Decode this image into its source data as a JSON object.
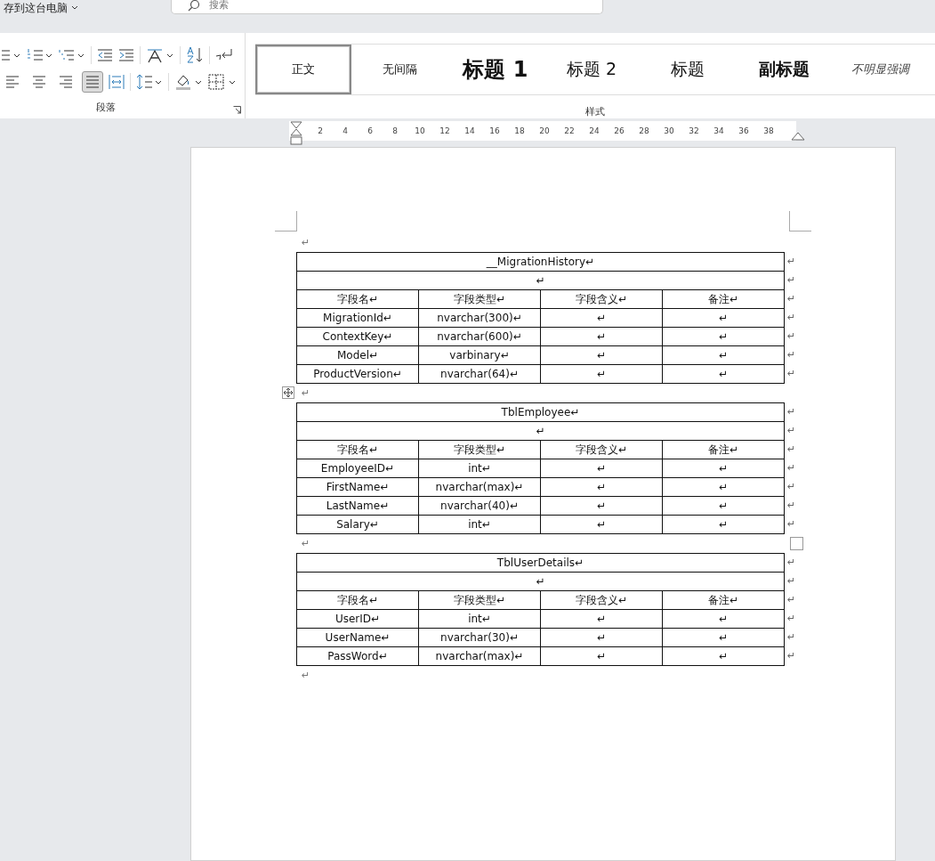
{
  "top_bar": {
    "save_location": "存到这台电脑",
    "search": {
      "placeholder": "搜索"
    }
  },
  "ribbon": {
    "paragraph": {
      "label": "段落",
      "align_buttons": [
        {
          "selected": false
        },
        {
          "selected": false
        },
        {
          "selected": false
        },
        {
          "selected": true
        }
      ]
    },
    "styles": {
      "label": "样式",
      "items": [
        {
          "label": "正文",
          "kind": "normal",
          "selected": true
        },
        {
          "label": "无间隔",
          "kind": "normal",
          "selected": false
        },
        {
          "label": "标题 1",
          "kind": "heading1",
          "selected": false
        },
        {
          "label": "标题 2",
          "kind": "heading2",
          "selected": false
        },
        {
          "label": "标题",
          "kind": "title",
          "selected": false
        },
        {
          "label": "副标题",
          "kind": "subtitle",
          "selected": false
        },
        {
          "label": "不明显强调",
          "kind": "emphasis",
          "selected": false
        }
      ]
    }
  },
  "ruler": [
    "2",
    "4",
    "6",
    "8",
    "10",
    "12",
    "14",
    "16",
    "18",
    "20",
    "22",
    "24",
    "26",
    "28",
    "30",
    "32",
    "34",
    "36",
    "38"
  ],
  "document": [
    {
      "kind": "paragraph",
      "text": "↵"
    },
    {
      "kind": "table",
      "rows": [
        {
          "cells": [
            {
              "text": "__MigrationHistory↵",
              "colspan": 4
            }
          ],
          "end": "↵"
        },
        {
          "cells": [
            {
              "text": "↵",
              "colspan": 4
            }
          ],
          "end": "↵"
        },
        {
          "cells": [
            "字段名↵",
            "字段类型↵",
            "字段含义↵",
            "备注↵"
          ],
          "end": "↵"
        },
        {
          "cells": [
            "MigrationId↵",
            "nvarchar(300)↵",
            "↵",
            "↵"
          ],
          "end": "↵"
        },
        {
          "cells": [
            "ContextKey↵",
            "nvarchar(600)↵",
            "↵",
            "↵"
          ],
          "end": "↵"
        },
        {
          "cells": [
            "Model↵",
            "varbinary↵",
            "↵",
            "↵"
          ],
          "end": "↵"
        },
        {
          "cells": [
            "ProductVersion↵",
            "nvarchar(64)↵",
            "↵",
            "↵"
          ],
          "end": "↵"
        }
      ]
    },
    {
      "kind": "paragraph",
      "text": "↵"
    },
    {
      "kind": "table",
      "rows": [
        {
          "cells": [
            {
              "text": "TblEmployee↵",
              "colspan": 4
            }
          ],
          "end": "↵"
        },
        {
          "cells": [
            {
              "text": "↵",
              "colspan": 4
            }
          ],
          "end": "↵"
        },
        {
          "cells": [
            "字段名↵",
            "字段类型↵",
            "字段含义↵",
            "备注↵"
          ],
          "end": "↵"
        },
        {
          "cells": [
            "EmployeeID↵",
            "int↵",
            "↵",
            "↵"
          ],
          "end": "↵"
        },
        {
          "cells": [
            "FirstName↵",
            "nvarchar(max)↵",
            "↵",
            "↵"
          ],
          "end": "↵"
        },
        {
          "cells": [
            "LastName↵",
            "nvarchar(40)↵",
            "↵",
            "↵"
          ],
          "end": "↵"
        },
        {
          "cells": [
            "Salary↵",
            "int↵",
            "↵",
            "↵"
          ],
          "end": "↵"
        }
      ]
    },
    {
      "kind": "paragraph",
      "text": "↵"
    },
    {
      "kind": "table",
      "rows": [
        {
          "cells": [
            {
              "text": "TblUserDetails↵",
              "colspan": 4
            }
          ],
          "end": "↵"
        },
        {
          "cells": [
            {
              "text": "↵",
              "colspan": 4
            }
          ],
          "end": "↵"
        },
        {
          "cells": [
            "字段名↵",
            "字段类型↵",
            "字段含义↵",
            "备注↵"
          ],
          "end": "↵"
        },
        {
          "cells": [
            "UserID↵",
            "int↵",
            "↵",
            "↵"
          ],
          "end": "↵"
        },
        {
          "cells": [
            "UserName↵",
            "nvarchar(30)↵",
            "↵",
            "↵"
          ],
          "end": "↵"
        },
        {
          "cells": [
            "PassWord↵",
            "nvarchar(max)↵",
            "↵",
            "↵"
          ],
          "end": "↵"
        }
      ]
    },
    {
      "kind": "paragraph",
      "text": "↵"
    }
  ]
}
